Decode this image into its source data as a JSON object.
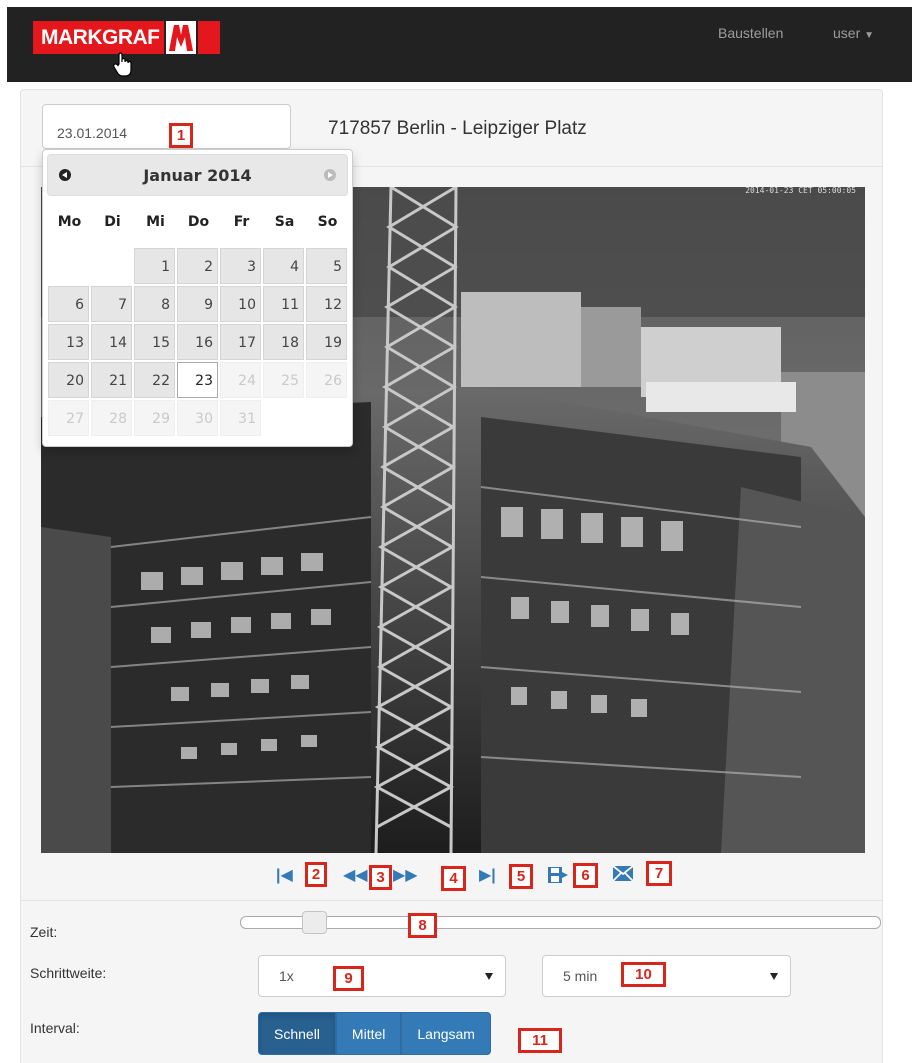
{
  "navbar": {
    "brand": "MARKGRAF",
    "links": {
      "baustellen": "Baustellen",
      "user": "user"
    },
    "brand_color": "#e3171c"
  },
  "toolbar": {
    "date_value": "23.01.2014",
    "site_title": "717857 Berlin - Leipziger Platz"
  },
  "datepicker": {
    "month_title": "Januar 2014",
    "weekdays": [
      "Mo",
      "Di",
      "Mi",
      "Do",
      "Fr",
      "Sa",
      "So"
    ],
    "selected_day": "23"
  },
  "camera": {
    "timestamp": "2014-01-23 CET 05:00:05"
  },
  "controls": {
    "first": "first-icon",
    "prev": "rewind-icon",
    "next": "fast-forward-icon",
    "last": "last-icon",
    "save": "save-icon",
    "mail": "mail-icon"
  },
  "callouts": [
    "1",
    "2",
    "3",
    "4",
    "5",
    "6",
    "7",
    "8",
    "9",
    "10",
    "11"
  ],
  "form": {
    "zeit_label": "Zeit:",
    "schrittweite_label": "Schrittweite:",
    "interval_label": "Interval:",
    "speed_select_value": "1x",
    "step_select_value": "5 min",
    "slider_position": 0.1,
    "interval_buttons": [
      "Schnell",
      "Mittel",
      "Langsam"
    ],
    "interval_selected": "Schnell"
  },
  "colors": {
    "accent": "#337ab7",
    "callout": "#d9261c",
    "navbar": "#222222"
  }
}
